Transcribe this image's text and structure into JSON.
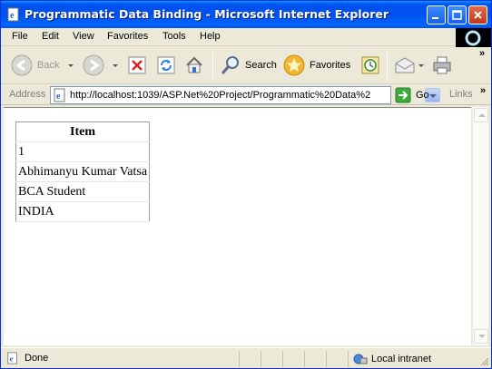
{
  "window": {
    "title": "Programmatic Data Binding - Microsoft Internet Explorer"
  },
  "menu": {
    "items": [
      "File",
      "Edit",
      "View",
      "Favorites",
      "Tools",
      "Help"
    ]
  },
  "toolbar": {
    "back_label": "Back",
    "search_label": "Search",
    "favorites_label": "Favorites"
  },
  "address": {
    "label": "Address",
    "url": "http://localhost:1039/ASP.Net%20Project/Programmatic%20Data%2",
    "go_label": "Go",
    "links_label": "Links"
  },
  "grid": {
    "header": "Item",
    "rows": [
      "1",
      "Abhimanyu Kumar Vatsa",
      "BCA Student",
      "INDIA"
    ]
  },
  "status": {
    "text": "Done",
    "zone": "Local intranet"
  },
  "icons": [
    "ie-page-icon",
    "minimize-icon",
    "maximize-icon",
    "close-icon",
    "windows-logo-icon",
    "back-arrow-icon",
    "forward-arrow-icon",
    "stop-icon",
    "refresh-icon",
    "home-icon",
    "search-icon",
    "favorites-star-icon",
    "history-icon",
    "mail-icon",
    "print-icon",
    "go-arrow-icon",
    "intranet-icon"
  ]
}
